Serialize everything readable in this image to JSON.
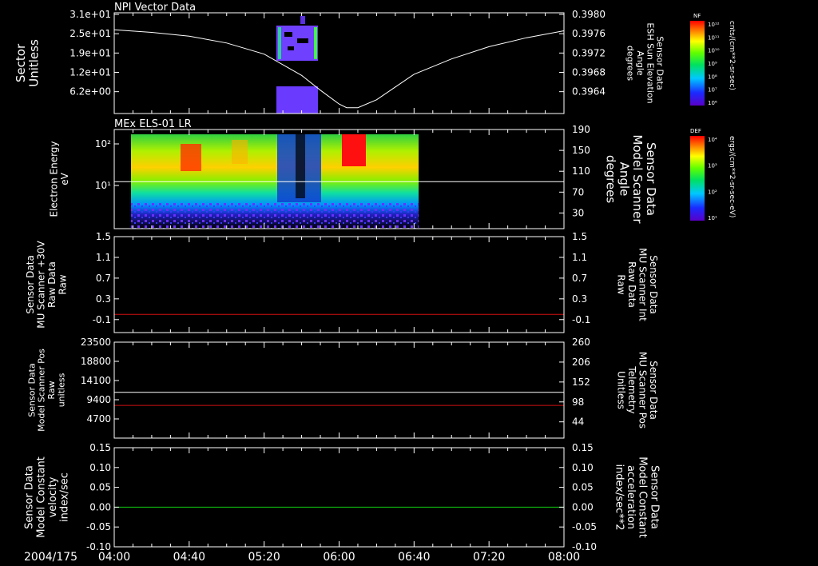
{
  "chart_data": [
    {
      "type": "heatmap",
      "title": "NPI Vector Data",
      "ylabel": "Sector\nUnitless",
      "yticks": [
        "3.1e+01",
        "2.5e+01",
        "1.9e+01",
        "1.2e+01",
        "6.2e+00"
      ],
      "right_axis": {
        "label": "Sensor Data\nESH Sun Elevation\nAngle\ndegrees",
        "ticks": [
          "0.3980",
          "0.3976",
          "0.3972",
          "0.3968",
          "0.3964"
        ],
        "ylim": [
          0.3961,
          0.398
        ]
      },
      "line_series": {
        "x": [
          0,
          20,
          40,
          60,
          80,
          100,
          110,
          120,
          124,
          130,
          140,
          150,
          160,
          180,
          200,
          220,
          240
        ],
        "y": [
          0.39768,
          0.39763,
          0.39756,
          0.39743,
          0.39722,
          0.39682,
          0.39654,
          0.39628,
          0.39621,
          0.39621,
          0.39636,
          0.3966,
          0.39684,
          0.39713,
          0.39736,
          0.39753,
          0.39766
        ]
      },
      "heat_block": {
        "x_start": 82,
        "x_end": 100
      },
      "colorbar": {
        "label": "cnts/(cm**2-sr-sec)",
        "title": "NF",
        "ticks": [
          "10¹²",
          "10¹¹",
          "10¹⁰",
          "10⁹",
          "10⁸",
          "10⁷",
          "10⁶"
        ]
      }
    },
    {
      "type": "heatmap",
      "title": "MEx ELS-01 LR",
      "ylabel": "Electron Energy\neV",
      "yticks": [
        "10²",
        "10¹"
      ],
      "right_axis": {
        "label": "Sensor Data\nModel Scanner\nAngle\ndegrees",
        "ticks": [
          "190",
          "150",
          "110",
          "70",
          "30"
        ],
        "ylim": [
          0,
          190
        ]
      },
      "hline": {
        "y": 90
      },
      "data_extent": {
        "x_start": 7,
        "x_end": 140
      },
      "colorbar": {
        "label": "ergs/(cm**2-sr-sec-eV)",
        "title": "DEF",
        "ticks": [
          "10⁴",
          "10³",
          "10²",
          "10¹"
        ]
      }
    },
    {
      "type": "line",
      "ylabel": "Sensor Data\nMU Scanner +30V\nRaw Data\nRaw",
      "yticks": [
        "1.5",
        "1.1",
        "0.7",
        "0.3",
        "-0.1"
      ],
      "ylim": [
        -0.35,
        1.5
      ],
      "right_axis": {
        "label": "Sensor Data\nMU Scanner Int\nRaw Data\nRaw",
        "ticks": [
          "1.5",
          "1.1",
          "0.7",
          "0.3",
          "-0.1"
        ]
      },
      "series": [
        {
          "color": "#d01010",
          "values": [
            0
          ]
        }
      ]
    },
    {
      "type": "line",
      "ylabel": "Sensor Data\nModel Scanner Pos\nRaw\nunitless",
      "yticks": [
        "23500",
        "18800",
        "14100",
        "9400",
        "4700"
      ],
      "ylim": [
        0,
        23500
      ],
      "right_axis": {
        "label": "Sensor Data\nMU Scanner Pos\nTelemetry\nUnitless",
        "ticks": [
          "260",
          "206",
          "152",
          "98",
          "44"
        ],
        "ylim": [
          0,
          260
        ]
      },
      "series": [
        {
          "color": "#ffffff",
          "values": [
            11200
          ]
        },
        {
          "color": "#d01010",
          "values": [
            8000
          ]
        }
      ]
    },
    {
      "type": "line",
      "ylabel": "Sensor Data\nModel Constant\nvelocity\nindex/sec",
      "yticks": [
        "0.15",
        "0.10",
        "0.05",
        "0.00",
        "-0.05",
        "-0.10"
      ],
      "ylim": [
        -0.1,
        0.15
      ],
      "right_axis": {
        "label": "Sensor Data\nModel Constant\nacceleration\nindex/sec**2",
        "ticks": [
          "0.15",
          "0.10",
          "0.05",
          "0.00",
          "-0.05",
          "-0.10"
        ]
      },
      "series": [
        {
          "color": "#10d010",
          "values": [
            0.0
          ]
        }
      ]
    }
  ],
  "x_axis": {
    "date_label": "2004/175",
    "range_minutes": [
      0,
      240
    ],
    "tick_labels": [
      "04:00",
      "04:40",
      "05:20",
      "06:00",
      "06:40",
      "07:20",
      "08:00"
    ],
    "tick_minutes": [
      0,
      40,
      80,
      120,
      160,
      200,
      240
    ]
  },
  "colors": {
    "background": "#000000",
    "axis": "#ffffff",
    "red_label": "#e01010",
    "green_label": "#10d010"
  }
}
